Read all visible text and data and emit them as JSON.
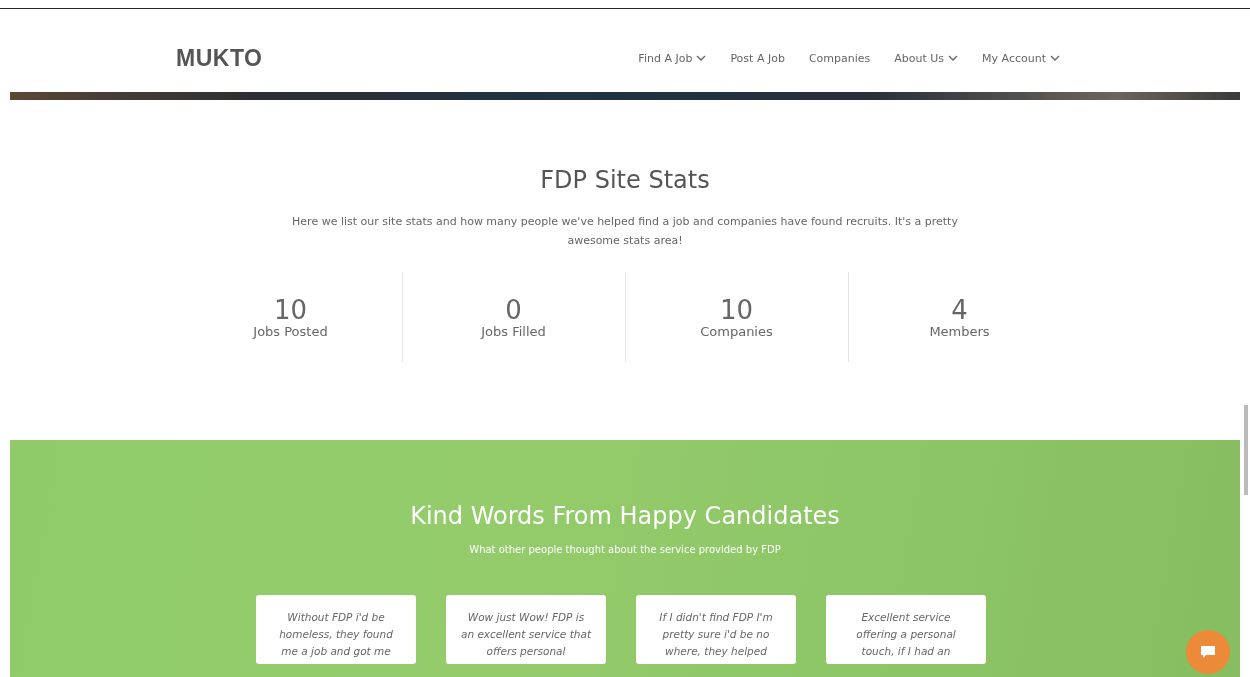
{
  "header": {
    "logo": "MUKTO",
    "nav": [
      {
        "label": "Find A Job",
        "dropdown": true
      },
      {
        "label": "Post A Job",
        "dropdown": false
      },
      {
        "label": "Companies",
        "dropdown": false
      },
      {
        "label": "About Us",
        "dropdown": true
      },
      {
        "label": "My Account",
        "dropdown": true
      }
    ]
  },
  "stats_section": {
    "title": "FDP Site Stats",
    "description": "Here we list our site stats and how many people we've helped find a job and companies have found recruits. It's a pretty awesome stats area!",
    "stats": [
      {
        "value": "10",
        "label": "Jobs Posted"
      },
      {
        "value": "0",
        "label": "Jobs Filled"
      },
      {
        "value": "10",
        "label": "Companies"
      },
      {
        "value": "4",
        "label": "Members"
      }
    ]
  },
  "testimonials_section": {
    "title": "Kind Words From Happy Candidates",
    "subtitle": "What other people thought about the service provided by FDP",
    "testimonials": [
      "Without FDP i'd be homeless, they found me a job and got me",
      "Wow just Wow! FDP is an excellent service that offers personal",
      "If I didn't find FDP I'm pretty sure i'd be no where, they helped",
      "Excellent service offering a personal touch, if I had an"
    ]
  }
}
